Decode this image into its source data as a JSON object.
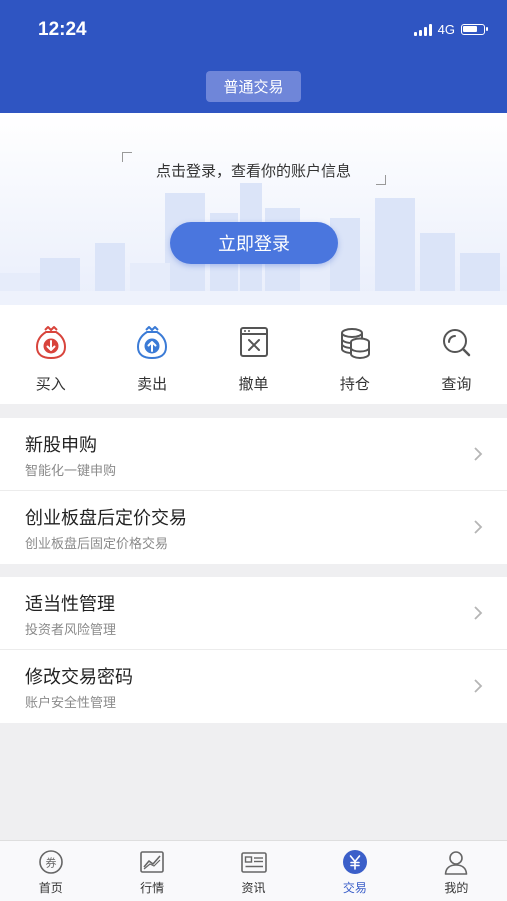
{
  "status_bar": {
    "time": "12:24",
    "network": "4G"
  },
  "header": {
    "title": "普通交易"
  },
  "login": {
    "prompt": "点击登录，查看你的账户信息",
    "button": "立即登录"
  },
  "quick_actions": [
    {
      "label": "买入",
      "icon": "buy-icon"
    },
    {
      "label": "卖出",
      "icon": "sell-icon"
    },
    {
      "label": "撤单",
      "icon": "cancel-order-icon"
    },
    {
      "label": "持仓",
      "icon": "holdings-icon"
    },
    {
      "label": "查询",
      "icon": "search-icon"
    }
  ],
  "menu_groups": [
    [
      {
        "title": "新股申购",
        "subtitle": "智能化一键申购"
      },
      {
        "title": "创业板盘后定价交易",
        "subtitle": "创业板盘后固定价格交易"
      }
    ],
    [
      {
        "title": "适当性管理",
        "subtitle": "投资者风险管理"
      },
      {
        "title": "修改交易密码",
        "subtitle": "账户安全性管理"
      }
    ]
  ],
  "tabbar": [
    {
      "label": "首页",
      "icon": "home-coupon-icon"
    },
    {
      "label": "行情",
      "icon": "market-chart-icon"
    },
    {
      "label": "资讯",
      "icon": "news-icon"
    },
    {
      "label": "交易",
      "icon": "trade-yen-icon",
      "active": true
    },
    {
      "label": "我的",
      "icon": "profile-icon"
    }
  ],
  "colors": {
    "brand": "#2f55c2",
    "accent": "#4a76de",
    "buy": "#d8443c",
    "sell": "#3b7bd6"
  }
}
